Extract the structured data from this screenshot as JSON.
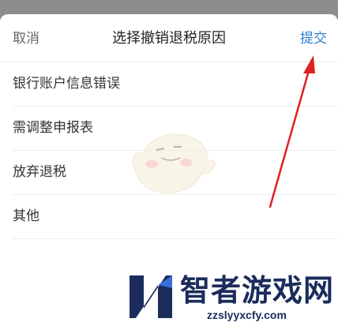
{
  "header": {
    "cancel_label": "取消",
    "title": "选择撤销退税原因",
    "submit_label": "提交"
  },
  "reasons": [
    {
      "label": "银行账户信息错误"
    },
    {
      "label": "需调整申报表"
    },
    {
      "label": "放弃退税"
    },
    {
      "label": "其他"
    }
  ],
  "watermark": {
    "site_name": "智者游戏网",
    "url": "zzslyyxcfy.com"
  },
  "colors": {
    "accent": "#2d7fd1",
    "arrow": "#e02020",
    "watermark": "#1b2c5c"
  }
}
